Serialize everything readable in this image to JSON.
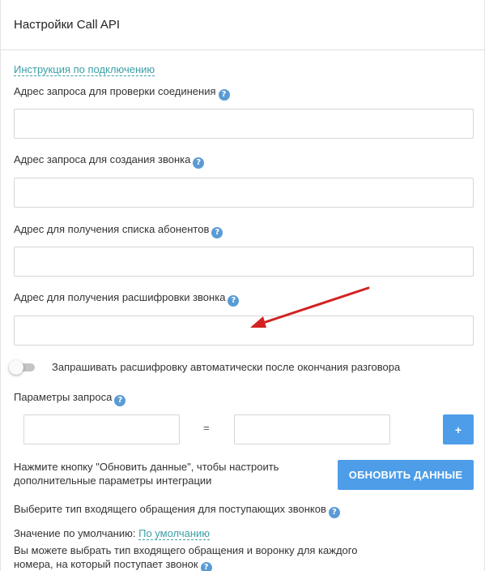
{
  "modal": {
    "title": "Настройки Call API"
  },
  "instruction_link": "Инструкция по подключению",
  "help_glyph": "?",
  "fields": {
    "check_connection": {
      "label": "Адрес запроса для проверки соединения",
      "value": ""
    },
    "create_call": {
      "label": "Адрес запроса для создания звонка",
      "value": ""
    },
    "subscribers": {
      "label": "Адрес для получения списка абонентов",
      "value": ""
    },
    "transcription": {
      "label": "Адрес для получения расшифровки звонка",
      "value": ""
    }
  },
  "toggle": {
    "label": "Запрашивать расшифровку автоматически после окончания разговора",
    "on": false
  },
  "params": {
    "label": "Параметры запроса",
    "key_value": "",
    "val_value": "",
    "eq": "=",
    "add_label": "+"
  },
  "update": {
    "hint": "Нажмите кнопку \"Обновить данные\", чтобы настроить дополнительные параметры интеграции",
    "button_label": "ОБНОВИТЬ ДАННЫЕ"
  },
  "incoming": {
    "label": "Выберите тип входящего обращения для поступающих звонков",
    "default_label": "Значение по умолчанию:",
    "default_value": "По умолчанию",
    "multi_note": "Вы можете выбрать тип входящего обращения и воронку для каждого номера, на который поступает звонок"
  },
  "colors": {
    "accent": "#4d9de8",
    "link": "#3a9fa6",
    "arrow": "#d32222",
    "help": "#5b9bd5"
  },
  "icons": {
    "help": "help-circle-icon",
    "arrow": "red-arrow-annotation"
  }
}
